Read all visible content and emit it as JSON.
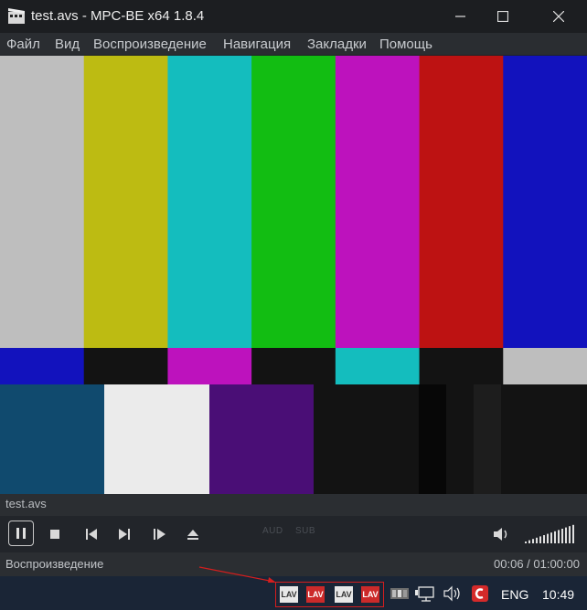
{
  "window": {
    "title": "test.avs - MPC-BE x64 1.8.4"
  },
  "menu": [
    "Файл",
    "Вид",
    "Воспроизведение",
    "Навигация",
    "Закладки",
    "Помощь"
  ],
  "video": {
    "top_bars": [
      "#bebebe",
      "#bdbb12",
      "#14bdbe",
      "#12bd12",
      "#bd12bd",
      "#bd1212",
      "#1212bd"
    ],
    "mid_bars": [
      "#1212bd",
      "#131313",
      "#bd12bd",
      "#131313",
      "#14bdbe",
      "#131313",
      "#bebebe"
    ],
    "bottom_blocks": [
      "#104a6e",
      "#ebebeb",
      "#4a0e76",
      "#131313",
      "#131313",
      "#070707",
      "#131313",
      "#1d1d1d",
      "#131313"
    ]
  },
  "filebar": {
    "filename": "test.avs"
  },
  "controls": {
    "aud_label": "AUD",
    "sub_label": "SUB",
    "volume_level": 1.0
  },
  "status": {
    "state": "Воспроизведение",
    "time": "00:06 / 01:00:00"
  },
  "taskbar": {
    "tray_icons": [
      "LAV",
      "LAV",
      "LAV",
      "LAV"
    ],
    "language": "ENG",
    "clock": "10:49"
  },
  "colors": {
    "titlebar": "#1c1e21",
    "menubar": "#2a2d31",
    "taskbar": "#1a2536",
    "highlight": "#d41e1e"
  }
}
